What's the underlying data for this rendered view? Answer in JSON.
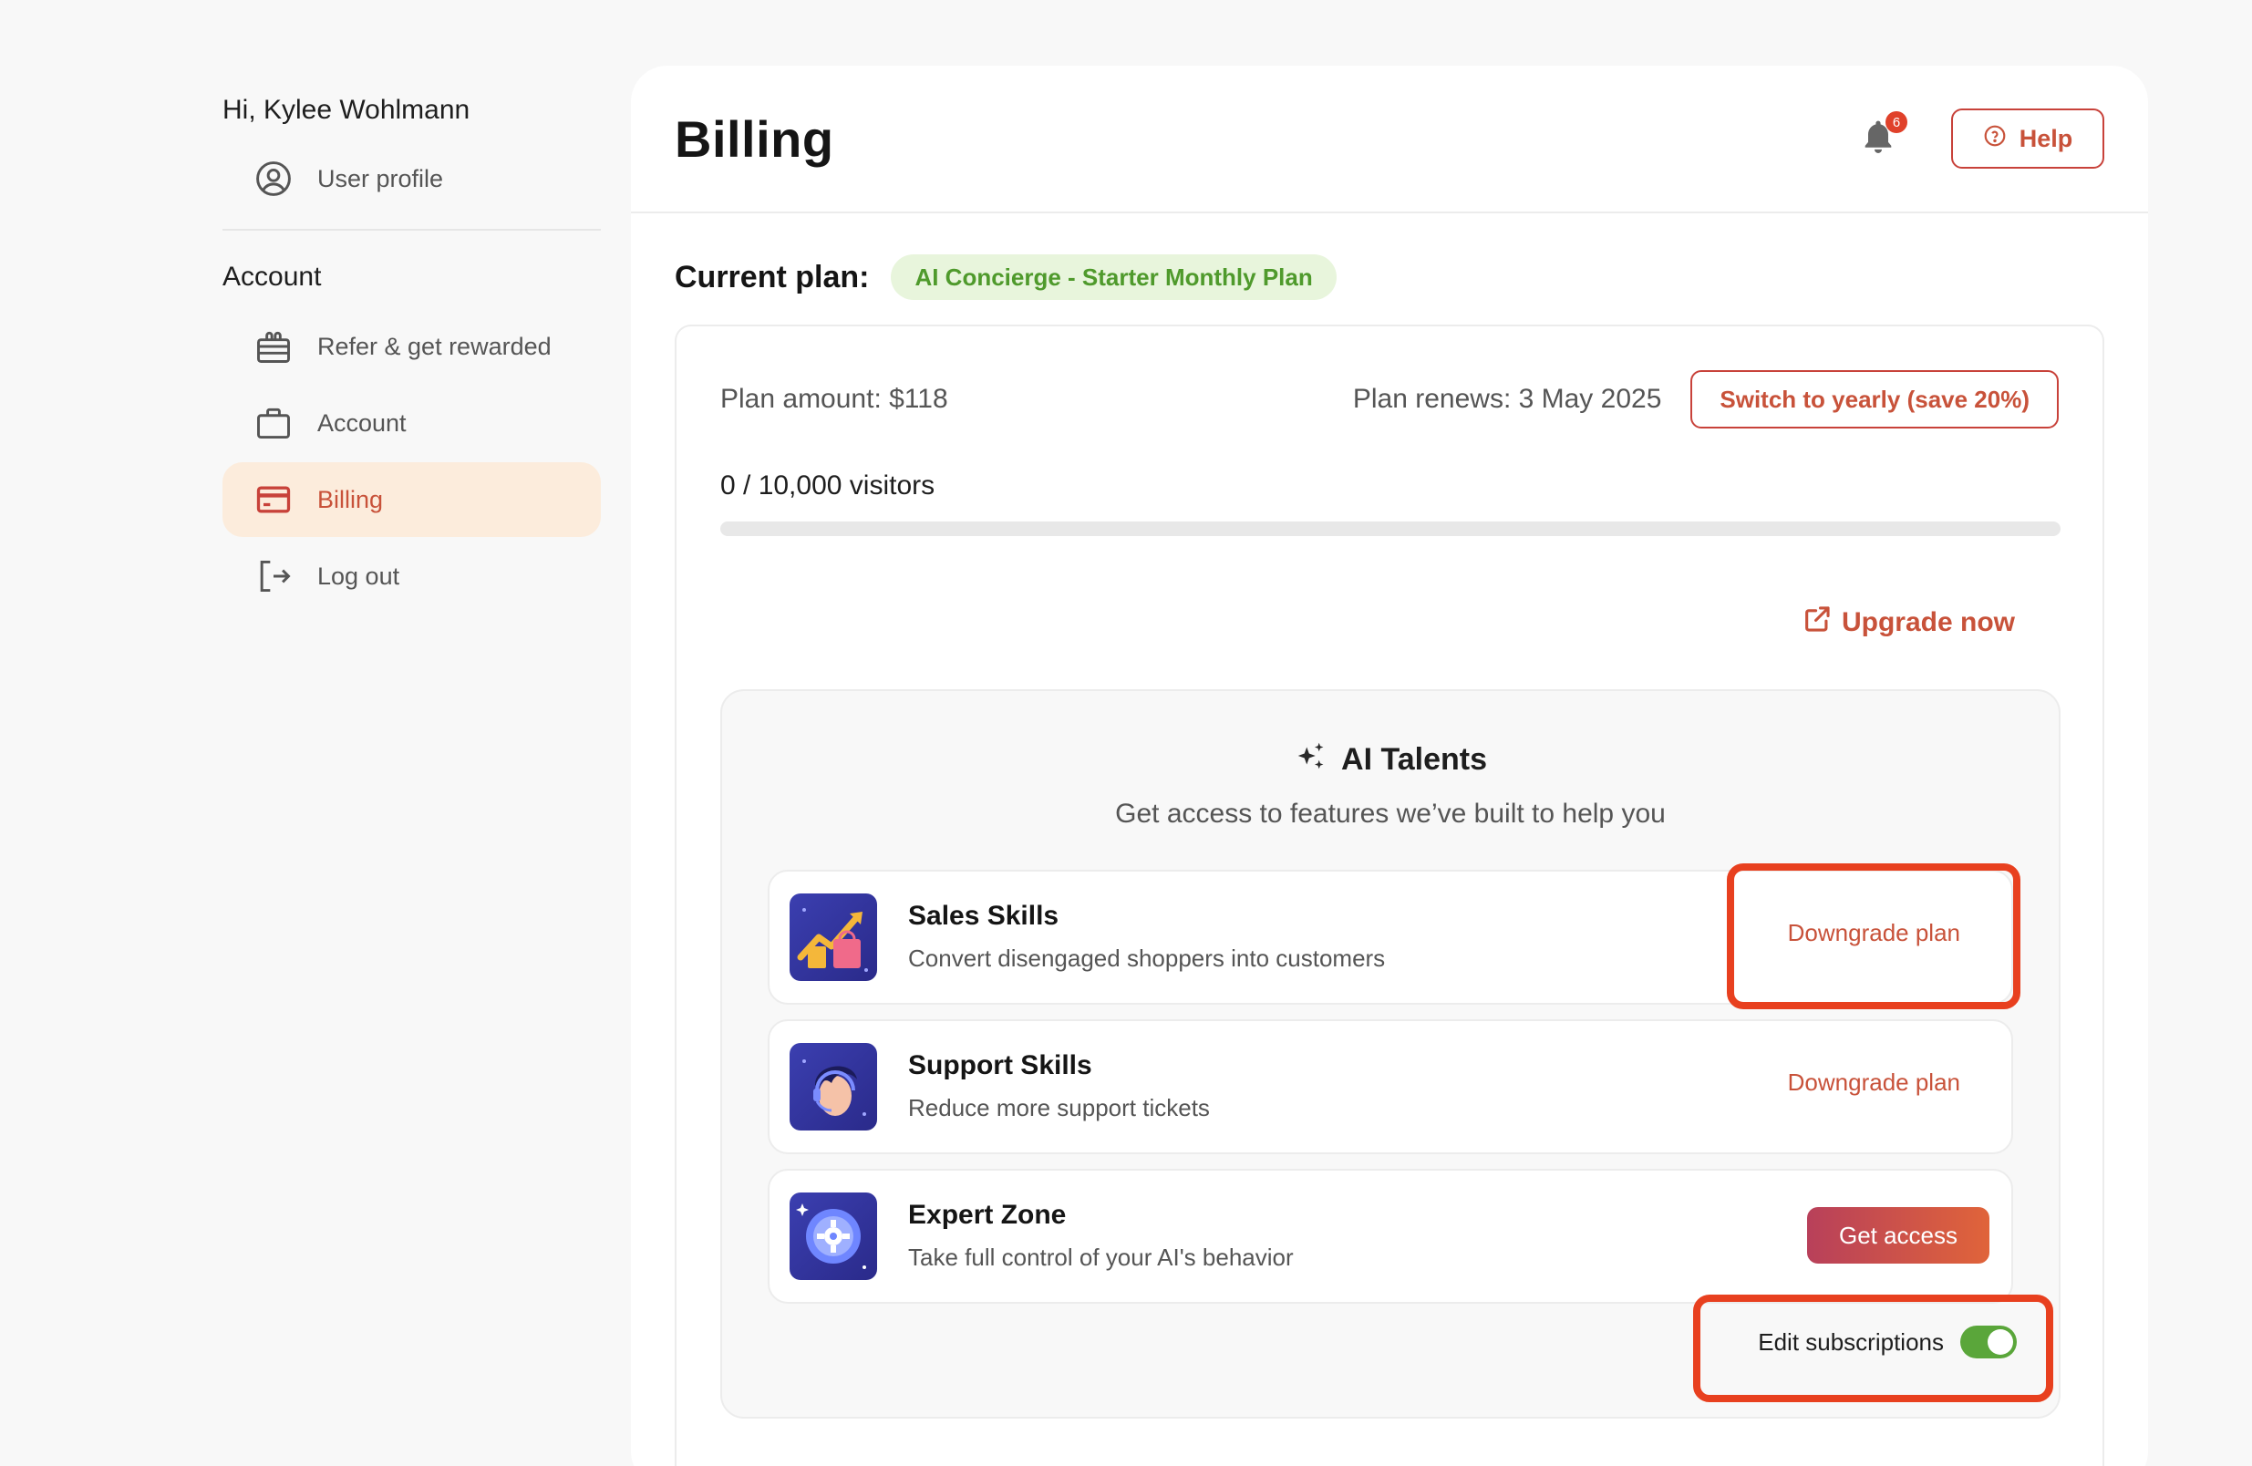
{
  "sidebar": {
    "greeting": "Hi, Kylee Wohlmann",
    "user_profile": "User profile",
    "section_title": "Account",
    "items": [
      {
        "label": "Refer & get rewarded",
        "icon": "gift-icon"
      },
      {
        "label": "Account",
        "icon": "briefcase-icon"
      },
      {
        "label": "Billing",
        "icon": "credit-card-icon",
        "active": true
      },
      {
        "label": "Log out",
        "icon": "logout-icon"
      }
    ]
  },
  "header": {
    "title": "Billing",
    "notification_count": "6",
    "help_label": "Help"
  },
  "plan": {
    "label": "Current plan:",
    "name": "AI Concierge - Starter Monthly Plan",
    "amount": "Plan amount: $118",
    "renews": "Plan renews: 3 May 2025",
    "switch_label": "Switch to yearly (save 20%)",
    "visitors": "0 / 10,000 visitors",
    "visitors_used_fraction": 0,
    "upgrade_label": "Upgrade now"
  },
  "talents": {
    "title": "AI Talents",
    "subtitle": "Get access to features we’ve built to help you",
    "skills": [
      {
        "name": "Sales Skills",
        "desc": "Convert disengaged shoppers into customers",
        "action": "Downgrade plan"
      },
      {
        "name": "Support Skills",
        "desc": "Reduce more support tickets",
        "action": "Downgrade plan"
      },
      {
        "name": "Expert Zone",
        "desc": "Take full control of your AI's behavior",
        "action": "Get access"
      }
    ],
    "edit_subscriptions": "Edit subscriptions",
    "edit_subscriptions_on": true
  },
  "colors": {
    "accent": "#c8523a",
    "active_bg": "#fcecdc",
    "plan_pill_bg": "#e8f5dc",
    "plan_pill_text": "#4f9a2c",
    "toggle_on": "#5aa63a",
    "highlight": "#e8401f"
  }
}
